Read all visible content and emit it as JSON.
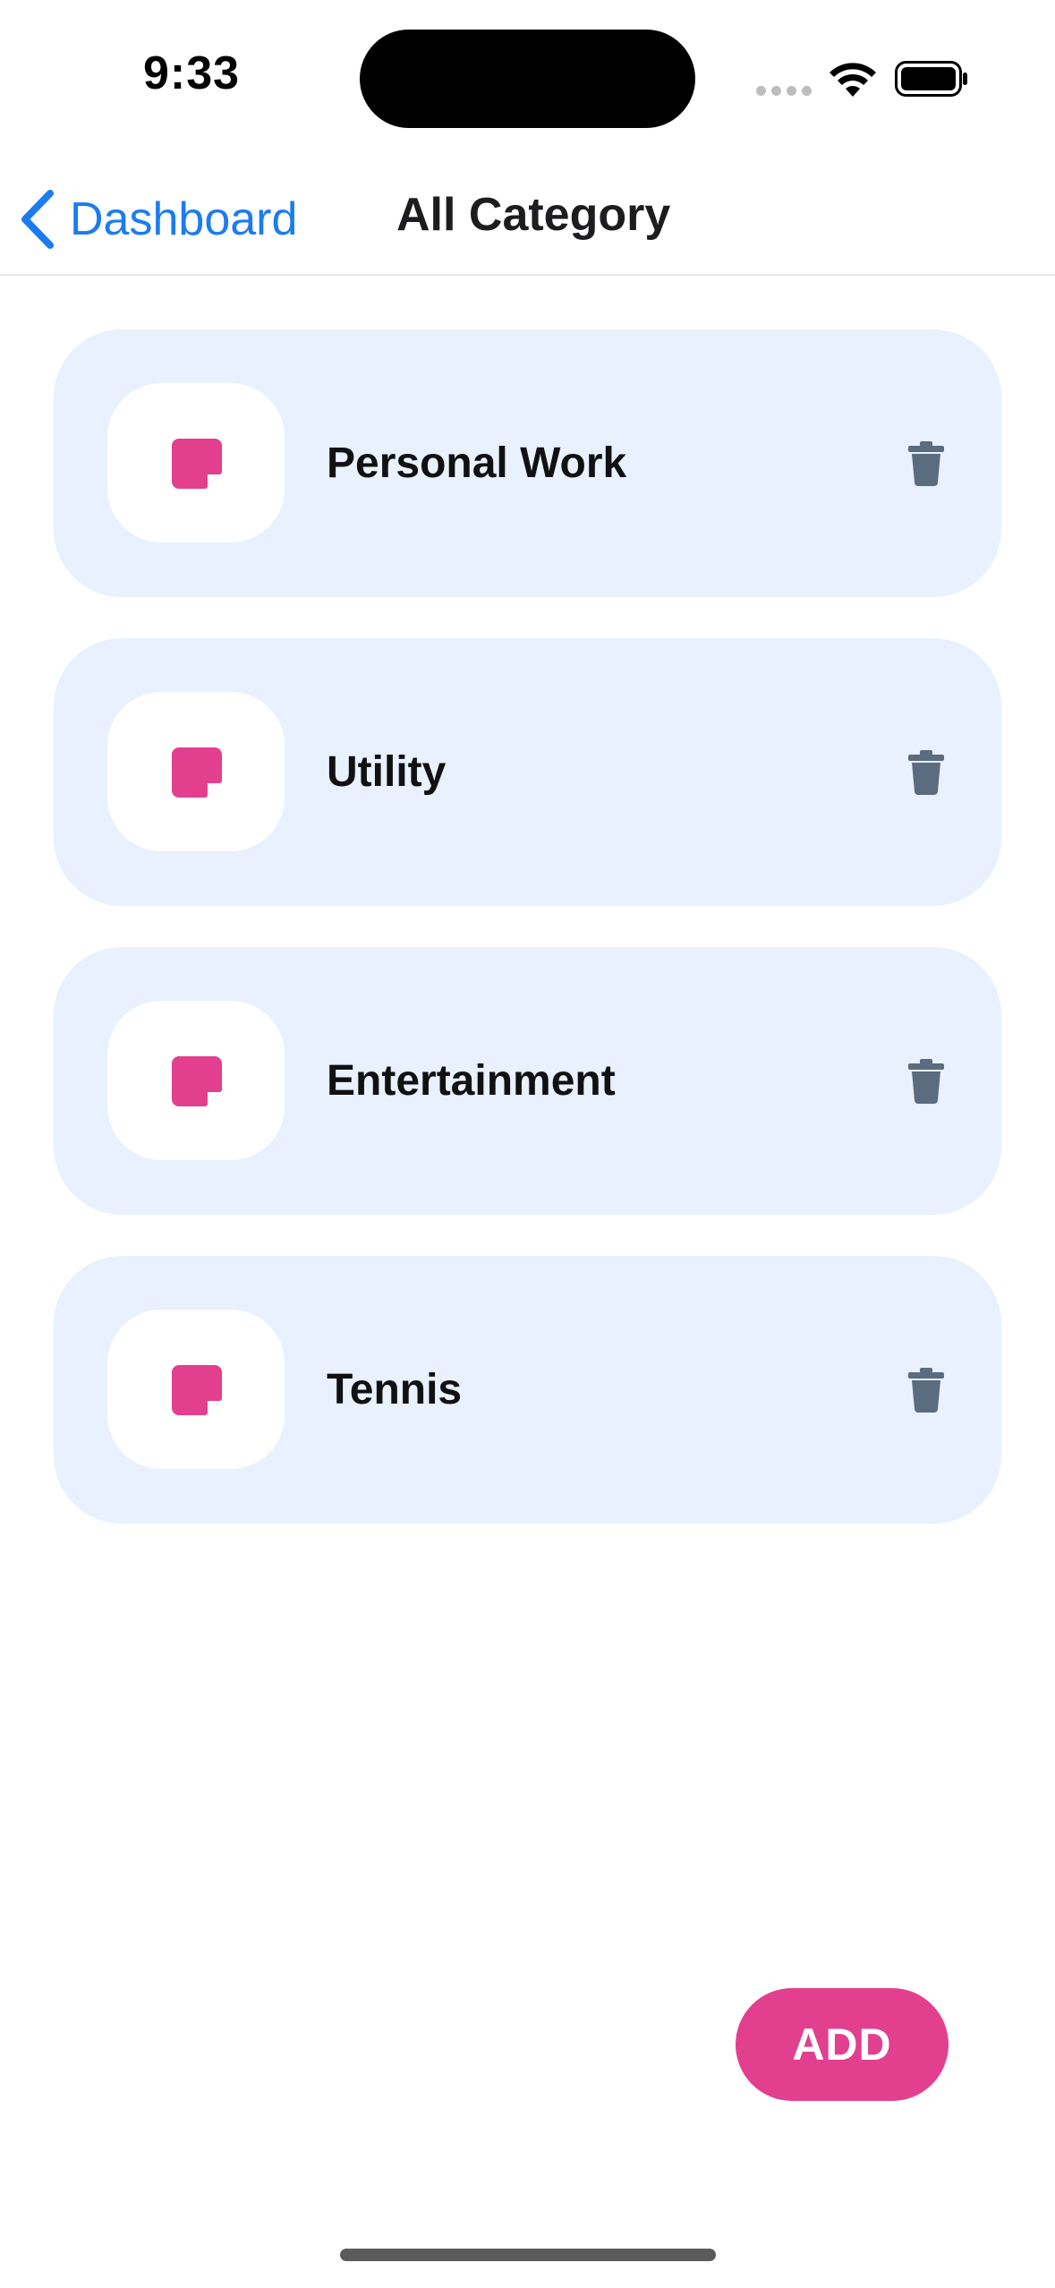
{
  "status_bar": {
    "time": "9:33"
  },
  "nav": {
    "back_label": "Dashboard",
    "title": "All Category"
  },
  "categories": [
    {
      "name": "Personal Work"
    },
    {
      "name": "Utility"
    },
    {
      "name": "Entertainment"
    },
    {
      "name": "Tennis"
    }
  ],
  "add_button": {
    "label": "ADD"
  },
  "colors": {
    "accent_pink": "#e33f8f",
    "link_blue": "#1a7cf0",
    "card_background": "#e8f1fd",
    "trash_gray": "#5b6b80"
  },
  "icons": {
    "category_icon": "note-icon",
    "delete_icon": "trash-icon",
    "back_icon": "chevron-left-icon"
  }
}
